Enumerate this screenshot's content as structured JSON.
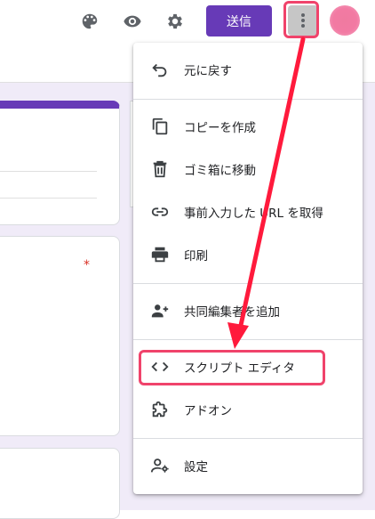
{
  "toolbar": {
    "send_label": "送信",
    "icons": [
      "palette-icon",
      "eye-icon",
      "gear-icon",
      "more-vert-icon"
    ]
  },
  "form": {
    "required_mark": "*"
  },
  "menu": {
    "items": [
      {
        "label": "元に戻す",
        "icon": "undo-icon"
      },
      {
        "label": "コピーを作成",
        "icon": "copy-icon"
      },
      {
        "label": "ゴミ箱に移動",
        "icon": "trash-icon"
      },
      {
        "label": "事前入力した URL を取得",
        "icon": "link-icon"
      },
      {
        "label": "印刷",
        "icon": "print-icon"
      },
      {
        "label": "共同編集者を追加",
        "icon": "person-add-icon"
      },
      {
        "label": "スクリプト エディタ",
        "icon": "code-icon"
      },
      {
        "label": "アドオン",
        "icon": "puzzle-icon"
      },
      {
        "label": "設定",
        "icon": "person-settings-icon"
      }
    ]
  },
  "colors": {
    "brand": "#673ab7",
    "highlight": "#f0436b",
    "arrow": "#ff1a3c",
    "canvas": "#f0ebf8"
  }
}
